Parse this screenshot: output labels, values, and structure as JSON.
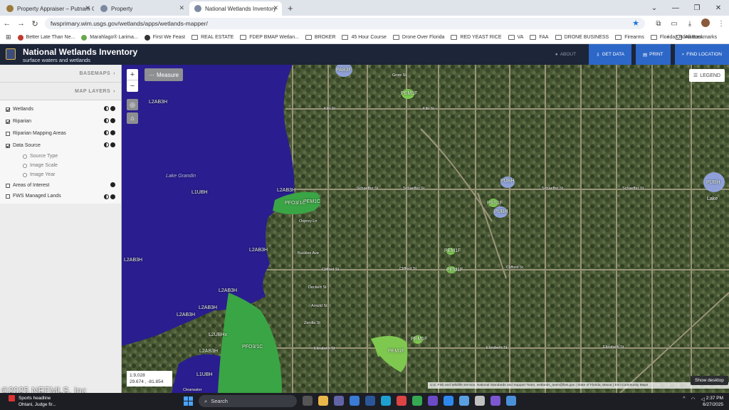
{
  "browser": {
    "tabs": [
      {
        "label": "Property Appraiser – Putnam C",
        "icon": "favicon-seal",
        "active": false
      },
      {
        "label": "Property",
        "icon": "favicon-globe",
        "active": false
      },
      {
        "label": "National Wetlands Inventory",
        "icon": "favicon-globe",
        "active": true
      }
    ],
    "url": "fwsprimary.wim.usgs.gov/wetlands/apps/wetlands-mapper/",
    "bookmarks": [
      "Better Late Than Ne...",
      "Marahlago® Larima...",
      "First We Feast",
      "REAL ESTATE",
      "FDEP BMAP Wetlan...",
      "BROKER",
      "45 Hour Course",
      "Drone Over Florida",
      "RED YEAST RICE",
      "VA",
      "FAA",
      "DRONE BUSINESS",
      "Firearms",
      "Florida Ordinances..."
    ],
    "all_bookmarks": "All Bookmarks",
    "more_bookmarks": "»"
  },
  "app": {
    "title": "National Wetlands Inventory",
    "subtitle": "surface waters and wetlands",
    "about": "ABOUT",
    "buttons": {
      "get_data": "GET DATA",
      "print": "PRINT",
      "find_location": "FIND LOCATION"
    }
  },
  "sidebar": {
    "basemaps": "BASEMAPS",
    "map_layers": "MAP LAYERS",
    "layers": [
      {
        "label": "Wetlands",
        "checked": true
      },
      {
        "label": "Riparian",
        "checked": true
      },
      {
        "label": "Riparian Mapping Areas",
        "checked": false
      },
      {
        "label": "Data Source",
        "checked": true
      },
      {
        "label": "Areas of Interest",
        "checked": false
      },
      {
        "label": "FWS Managed Lands",
        "checked": false
      }
    ],
    "data_source_options": [
      "Source Type",
      "Image Scale",
      "Image Year"
    ]
  },
  "map": {
    "measure": "Measure",
    "legend": "LEGEND",
    "scale": "1:9,028",
    "coords": "29.674 , -81.854",
    "attribution": "U.S. Fish and Wildlife Service, National Standards and Support Team, wetlands_team@fws.gov | State of Florida, Maxar | Esri Community Maps",
    "water_name": "Lake Grandin",
    "lake_take": "Lake",
    "wetland_codes": {
      "pab3f": "PAB3F",
      "pem1f_top": "PEM1F",
      "l2ab3h_a": "L2AB3H",
      "pubh_right": "PUBH",
      "l1ubh": "L1UBH",
      "l2ab3h_b": "L2AB3H",
      "pfo3c": "PFO3/1C",
      "pem1c": "PEM1C",
      "l2ab3h_c": "L2AB3H",
      "l2ab3h_d": "L2AB3H",
      "l2ab3h_e": "L2AB3H",
      "l2ab3h_f": "L2AB3H",
      "l2ubhx": "L2UBHx",
      "pfo3_1c": "PFO3/1C",
      "l2ab3h_g": "L2AB3H",
      "l1ubh_b": "L1UBH",
      "pubh_mid": "PUBH",
      "pss1f": "PSS1F",
      "pubh_mid2": "PUBH",
      "pem1f_small": "PEM1F",
      "pem1f_mid": "PEM1F",
      "pem1f_bottom": "PEM1F",
      "pem1f_bottom2": "PEM1F",
      "pem1f_b3": "PEM1F"
    },
    "streets": {
      "grow": "Grow St",
      "kiln_left": "Kiln St",
      "kiln_right": "Kiln St",
      "schaeffer_left": "Schaeffer St",
      "schaeffer_mid": "Schaeffer St",
      "schaeffer_right": "Schaeffer St",
      "schaeffer_far": "Schaeffer St",
      "osprey": "Osprey Ln",
      "buckles": "Buckles Ave",
      "clifford_left": "Clifford St",
      "clifford_mid": "Clifford St",
      "clifford_right": "Clifford St",
      "deckert": "Deckert St",
      "arnold": "Arnold St",
      "zanilla": "Zenilla St",
      "elizabeth_left": "Elizabeth St",
      "elizabeth_mid": "Elizabeth St",
      "elizabeth_right": "Elizabeth St",
      "clearwater": "Clearwater"
    }
  },
  "overlay": {
    "watermark": "©2025 NEFMLS, Inc",
    "show_desktop": "Show desktop"
  },
  "taskbar": {
    "news_title": "Sports headline",
    "news_sub": "Ohtani, Judge fir...",
    "search_placeholder": "Search",
    "time": "2:37 PM",
    "date": "6/27/2025"
  },
  "colors": {
    "water": "#2a1d8f",
    "wetland_forest": "#3aa545",
    "wetland_emergent": "#7ec850",
    "pond": "#8fa0d8",
    "header": "#1d2538",
    "button": "#2d67c8"
  }
}
